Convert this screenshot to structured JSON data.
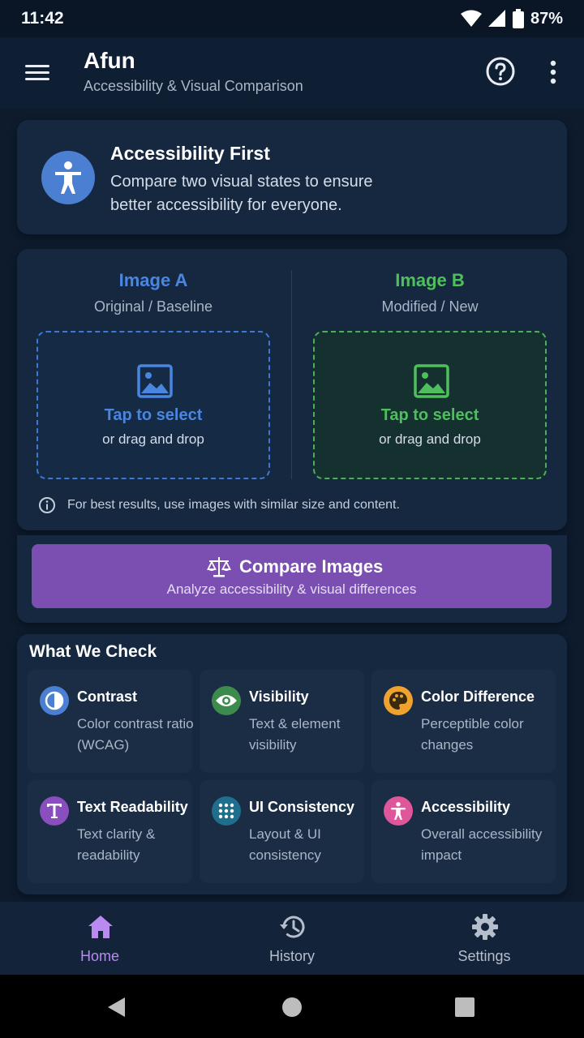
{
  "status": {
    "time": "11:42",
    "battery": "87%"
  },
  "app_bar": {
    "title": "Afun",
    "subtitle": "Accessibility & Visual Comparison"
  },
  "hero": {
    "title": "Accessibility First",
    "text": "Compare two visual states to ensure better accessibility for everyone."
  },
  "images": {
    "a": {
      "title": "Image A",
      "subtitle": "Original / Baseline",
      "action": "Tap to select",
      "hint": "or drag and drop",
      "color": "#4a86e0"
    },
    "b": {
      "title": "Image B",
      "subtitle": "Modified / New",
      "action": "Tap to select",
      "hint": "or drag and drop",
      "color": "#4fbf5e"
    },
    "tip": "For best results, use images with similar size and content."
  },
  "compare": {
    "label": "Compare Images",
    "sublabel": "Analyze accessibility & visual differences",
    "color": "#7b4fb1"
  },
  "checks": {
    "title": "What We Check",
    "items": [
      {
        "title": "Contrast",
        "desc": "Color contrast ratio (WCAG)",
        "icon": "contrast-icon",
        "color": "#4a7fd2"
      },
      {
        "title": "Visibility",
        "desc": "Text & element visibility",
        "icon": "eye-icon",
        "color": "#3d8b4c"
      },
      {
        "title": "Color Difference",
        "desc": "Perceptible color changes",
        "icon": "palette-icon",
        "color": "#f0a22e"
      },
      {
        "title": "Text Readability",
        "desc": "Text clarity & readability",
        "icon": "text-icon",
        "color": "#8a4fbf"
      },
      {
        "title": "UI Consistency",
        "desc": "Layout & UI consistency",
        "icon": "grid-icon",
        "color": "#1f6f8c"
      },
      {
        "title": "Accessibility",
        "desc": "Overall accessibility impact",
        "icon": "accessibility-icon",
        "color": "#e0569a"
      }
    ]
  },
  "nav": {
    "items": [
      {
        "label": "Home",
        "icon": "home-icon",
        "active": true
      },
      {
        "label": "History",
        "icon": "history-icon",
        "active": false
      },
      {
        "label": "Settings",
        "icon": "settings-icon",
        "active": false
      }
    ],
    "active_color": "#b98af0",
    "inactive_color": "#b5bfcc"
  }
}
